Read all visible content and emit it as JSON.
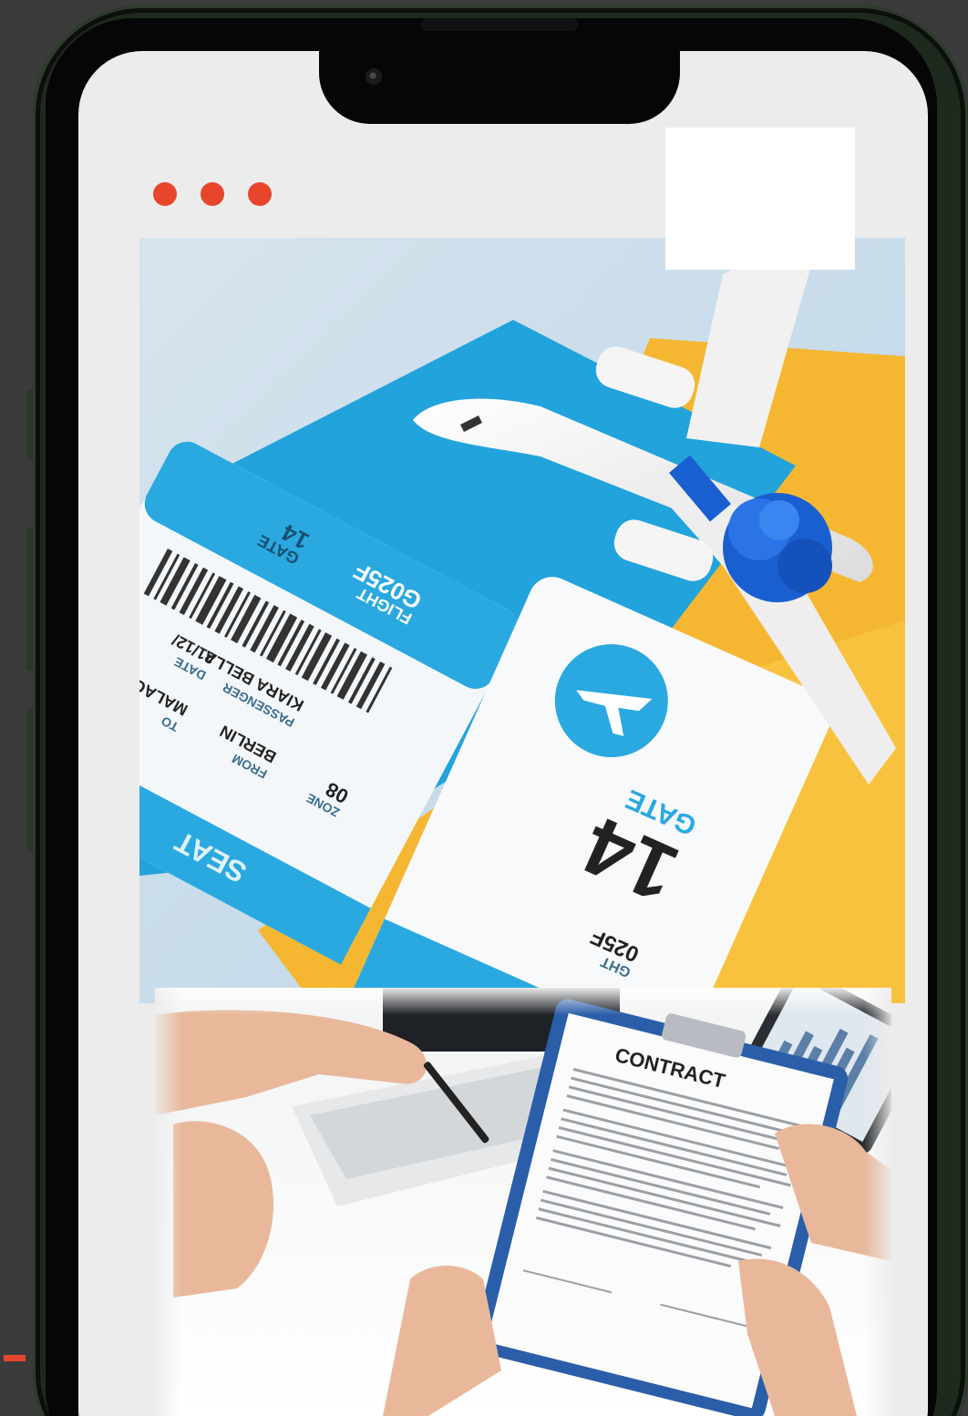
{
  "colors": {
    "accent": "#e8462b",
    "ticket_blue": "#29a9e0",
    "envelope_yellow": "#f5b731"
  },
  "icons": {
    "dots": [
      "dot-icon",
      "dot-icon",
      "dot-icon"
    ]
  },
  "boarding_pass": {
    "flight_label": "FLIGHT",
    "flight_value": "G025F",
    "gate_label": "GATE",
    "gate_value": "14",
    "zone_label": "ZONE",
    "zone_value": "08",
    "to_label": "TO",
    "to_value": "MALAGA",
    "from_label": "FROM",
    "from_value": "BERLIN",
    "passenger_label": "PASSENGER",
    "passenger_value": "KIARA BELLA",
    "date_label": "DATE",
    "date_value": "21/12/",
    "seat_label": "SEAT",
    "stub_gate_label": "GATE",
    "stub_gate_value": "14",
    "stub_flight_label": "GHT",
    "stub_flight_value": "025F"
  },
  "contract": {
    "title": "CONTRACT"
  }
}
